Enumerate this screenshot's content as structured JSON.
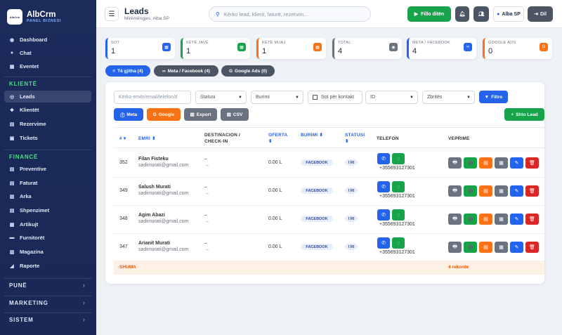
{
  "brand": {
    "name": "AlbCrm",
    "sub": "PANEL BIZNESI",
    "logo_text": "AlbCrm"
  },
  "sidebar": {
    "top": [
      {
        "label": "Dashboard",
        "icon": "dashboard-icon",
        "glyph": "◉"
      },
      {
        "label": "Chat",
        "icon": "chat-icon",
        "glyph": "●"
      },
      {
        "label": "Eventet",
        "icon": "calendar-icon",
        "glyph": "▦"
      }
    ],
    "sections": [
      {
        "title": "KLIENTË",
        "items": [
          {
            "label": "Leads",
            "icon": "leads-icon",
            "glyph": "◎",
            "active": true
          },
          {
            "label": "Klientët",
            "icon": "users-icon",
            "glyph": "❖"
          },
          {
            "label": "Rezervime",
            "icon": "booking-icon",
            "glyph": "▤"
          },
          {
            "label": "Tickets",
            "icon": "ticket-icon",
            "glyph": "▣"
          }
        ]
      },
      {
        "title": "FINANCË",
        "items": [
          {
            "label": "Preventive",
            "icon": "quote-icon",
            "glyph": "▤"
          },
          {
            "label": "Faturat",
            "icon": "invoice-icon",
            "glyph": "▤"
          },
          {
            "label": "Arka",
            "icon": "cash-icon",
            "glyph": "▥"
          },
          {
            "label": "Shpenzimet",
            "icon": "expenses-icon",
            "glyph": "▤"
          },
          {
            "label": "Artikujt",
            "icon": "items-icon",
            "glyph": "▦"
          },
          {
            "label": "Furnitorët",
            "icon": "supplier-icon",
            "glyph": "▬"
          },
          {
            "label": "Magazina",
            "icon": "warehouse-icon",
            "glyph": "▥"
          },
          {
            "label": "Raporte",
            "icon": "report-icon",
            "glyph": "◢"
          }
        ]
      }
    ],
    "collapsed": [
      "PUNË",
      "MARKETING",
      "SISTEM"
    ]
  },
  "header": {
    "title": "Leads",
    "subtitle": "Mirëmëngjes, Alba SP",
    "search_placeholder": "Kërko lead, klient, faturë, rezervim...",
    "clock_in": "Fillo ditën",
    "user": "Alba SP",
    "logout": "Dil"
  },
  "stats": [
    {
      "label": "SOT",
      "value": "1",
      "color": "#2563eb",
      "icon": "calendar-icon"
    },
    {
      "label": "KËTË JAVË",
      "value": "1",
      "color": "#16a34a",
      "icon": "week-icon"
    },
    {
      "label": "KËTË MUAJ",
      "value": "1",
      "color": "#f97316",
      "icon": "month-icon"
    },
    {
      "label": "TOTAL",
      "value": "4",
      "color": "#6b7280",
      "icon": "total-icon"
    },
    {
      "label": "META / FACEBOOK",
      "value": "4",
      "color": "#2563eb",
      "icon": "meta-icon"
    },
    {
      "label": "GOOGLE ADS",
      "value": "0",
      "color": "#f97316",
      "icon": "google-icon"
    }
  ],
  "tabs": [
    {
      "label": "Të gjitha (4)"
    },
    {
      "label": "Meta / Facebook (4)"
    },
    {
      "label": "Google Ads (0)"
    }
  ],
  "filters": {
    "search_placeholder": "Kërko emër/email/telefon/d",
    "status": "Statusi",
    "source": "Burimi",
    "no_contact": "Sot për kontakt",
    "sort_field": "ID",
    "order": "Zbritës",
    "filter_btn": "Filtro"
  },
  "actions": {
    "meta": "Meta",
    "google": "Google",
    "export": "Export",
    "csv": "CSV",
    "add": "Shto Lead"
  },
  "table": {
    "headers": {
      "id": "#",
      "name": "EMRI",
      "dest": "DESTINACION / CHECK-IN",
      "offer": "OFERTA",
      "source": "BURIMI",
      "status": "STATUSI",
      "phone": "TELEFON",
      "actions": "VEPRIME"
    },
    "rows": [
      {
        "id": "352",
        "name": "Filan Fisteku",
        "email": "sadimurati@gmail.com",
        "dest": "–",
        "checkin": "→",
        "offer": "0.00 L",
        "source": "FACEBOOK",
        "status": "I RI",
        "phone": "+355693127301"
      },
      {
        "id": "349",
        "name": "Salush Murati",
        "email": "sadimurati@gmail.com",
        "dest": "–",
        "checkin": "→",
        "offer": "0.00 L",
        "source": "FACEBOOK",
        "status": "I RI",
        "phone": "+355693127301"
      },
      {
        "id": "348",
        "name": "Agim Abazi",
        "email": "sadimurati@gmail.com",
        "dest": "–",
        "checkin": "→",
        "offer": "0.00 L",
        "source": "FACEBOOK",
        "status": "I RI",
        "phone": "+355693127301"
      },
      {
        "id": "347",
        "name": "Arianit Murati",
        "email": "sadimurati@gmail.com",
        "dest": "–",
        "checkin": "→",
        "offer": "0.00 L",
        "source": "FACEBOOK",
        "status": "I RI",
        "phone": "+355693127301"
      }
    ],
    "total_label": "SHUMA",
    "total_records": "4 rekorde"
  }
}
